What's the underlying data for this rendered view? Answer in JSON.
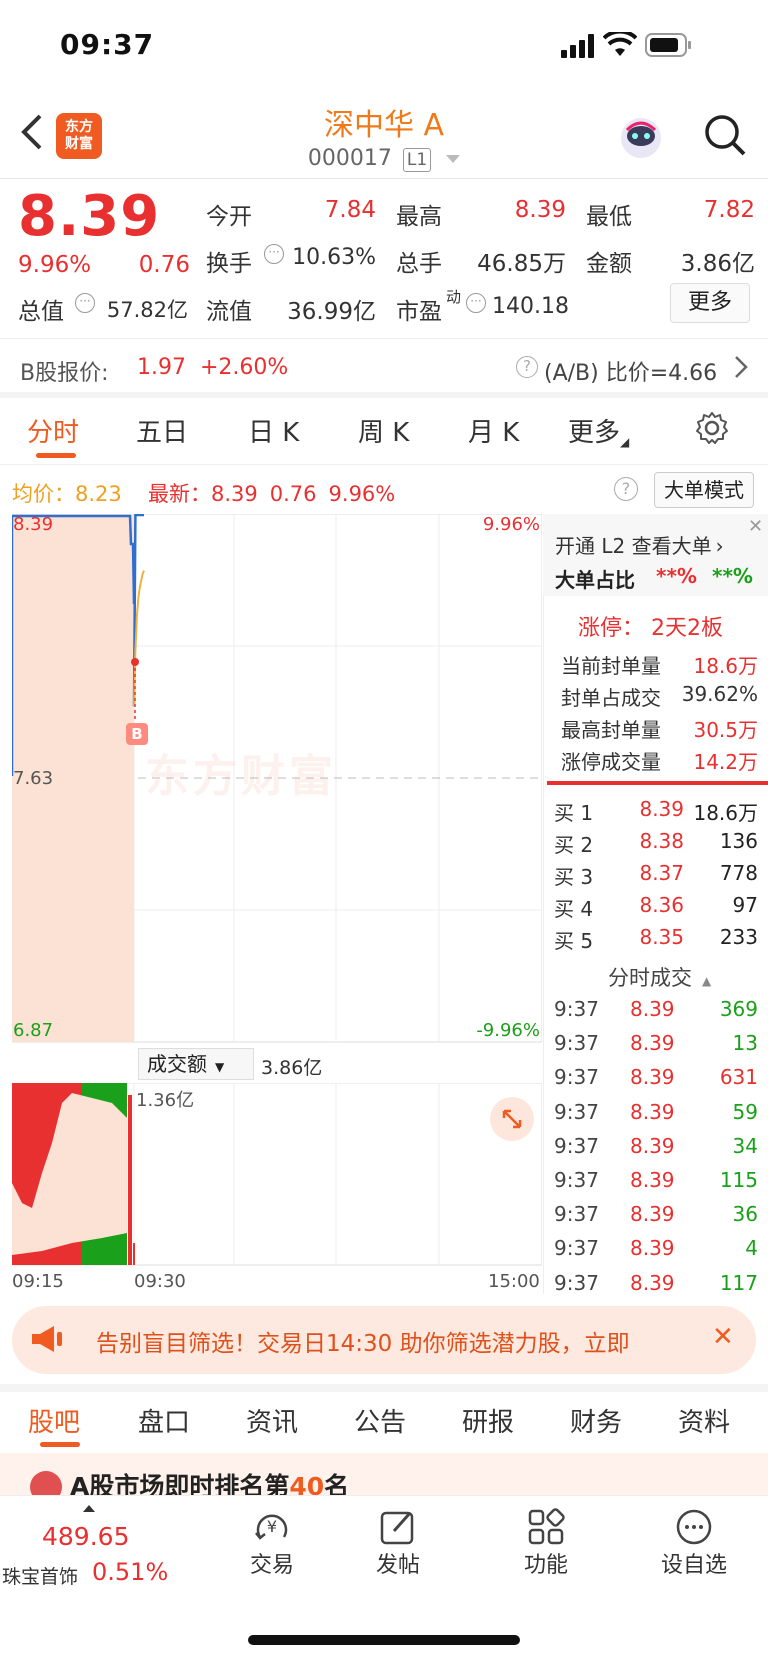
{
  "status_bar": {
    "time": "09:37"
  },
  "header": {
    "logo_text_1": "东方",
    "logo_text_2": "财富",
    "title": "深中华 A",
    "code": "000017",
    "level": "L1"
  },
  "quote": {
    "price": "8.39",
    "change_pct": "9.96%",
    "change": "0.76",
    "open_label": "今开",
    "open": "7.84",
    "high_label": "最高",
    "high": "8.39",
    "low_label": "最低",
    "low": "7.82",
    "turnover_label": "换手",
    "turnover": "10.63%",
    "volume_label": "总手",
    "volume": "46.85万",
    "amount_label": "金额",
    "amount": "3.86亿",
    "mcap_label": "总值",
    "mcap": "57.82亿",
    "float_label": "流值",
    "float_cap": "36.99亿",
    "pe_label": "市盈",
    "pe_sup": "动",
    "pe": "140.18",
    "more_label": "更多"
  },
  "b_share": {
    "label": "B股报价:",
    "price": "1.97",
    "change_pct": "+2.60%",
    "ratio_label": "(A/B) 比价=4.66"
  },
  "chart_tabs": [
    "分时",
    "五日",
    "日 K",
    "周 K",
    "月 K",
    "更多"
  ],
  "legend": {
    "avg_label": "均价：",
    "avg": "8.23",
    "latest_label": "最新：",
    "latest": "8.39",
    "change": "0.76",
    "change_pct": "9.96%",
    "big_order_mode": "大单模式"
  },
  "chart_labels": {
    "top_price": "8.39",
    "top_pct": "9.96%",
    "mid_price": "7.63",
    "bottom_price": "6.87",
    "bottom_pct": "-9.96%",
    "watermark": "东方财富",
    "b_marker": "B",
    "vol_selector": "成交额",
    "vol_total": "3.86亿",
    "vol_max": "1.36亿",
    "time_start": "09:15",
    "time_mid": "09:30",
    "time_end": "15:00"
  },
  "chart_data": {
    "type": "line",
    "x": [
      "09:30",
      "09:31",
      "09:32",
      "09:33",
      "09:34",
      "09:35",
      "09:36",
      "09:37"
    ],
    "series": [
      {
        "name": "price",
        "values": [
          7.84,
          8.39,
          8.39,
          8.39,
          8.39,
          8.39,
          8.39,
          8.39
        ]
      },
      {
        "name": "avg",
        "values": [
          7.84,
          8.0,
          8.1,
          8.15,
          8.18,
          8.2,
          8.22,
          8.23
        ]
      }
    ],
    "ylim": [
      6.87,
      8.39
    ],
    "title": ""
  },
  "side_panel": {
    "l2_link": "开通 L2 查看大单",
    "big_ratio_label": "大单占比",
    "big_ratio_red": "**%",
    "big_ratio_green": "**%",
    "limit_up": "涨停：  2天2板",
    "seal_items": [
      {
        "label": "当前封单量",
        "value": "18.6万"
      },
      {
        "label": "封单占成交",
        "value": "39.62%"
      },
      {
        "label": "最高封单量",
        "value": "30.5万"
      },
      {
        "label": "涨停成交量",
        "value": "14.2万"
      }
    ],
    "bids": [
      {
        "label": "买 1",
        "price": "8.39",
        "vol": "18.6万"
      },
      {
        "label": "买 2",
        "price": "8.38",
        "vol": "136"
      },
      {
        "label": "买 3",
        "price": "8.37",
        "vol": "778"
      },
      {
        "label": "买 4",
        "price": "8.36",
        "vol": "97"
      },
      {
        "label": "买 5",
        "price": "8.35",
        "vol": "233"
      }
    ],
    "ticks_title": "分时成交",
    "ticks": [
      {
        "time": "9:37",
        "price": "8.39",
        "vol": "369"
      },
      {
        "time": "9:37",
        "price": "8.39",
        "vol": "13"
      },
      {
        "time": "9:37",
        "price": "8.39",
        "vol": "631"
      },
      {
        "time": "9:37",
        "price": "8.39",
        "vol": "59"
      },
      {
        "time": "9:37",
        "price": "8.39",
        "vol": "34"
      },
      {
        "time": "9:37",
        "price": "8.39",
        "vol": "115"
      },
      {
        "time": "9:37",
        "price": "8.39",
        "vol": "36"
      },
      {
        "time": "9:37",
        "price": "8.39",
        "vol": "4"
      },
      {
        "time": "9:37",
        "price": "8.39",
        "vol": "117"
      }
    ]
  },
  "banner": {
    "text": "告别盲目筛选！交易日14:30 助你筛选潜力股，立即"
  },
  "bottom_tabs": [
    "股吧",
    "盘口",
    "资讯",
    "公告",
    "研报",
    "财务",
    "资料"
  ],
  "rank_strip": {
    "prefix": "A股市场即时排名第",
    "rank": "40",
    "suffix": "名"
  },
  "bottom_bar": {
    "sector_value": "489.65",
    "sector_name": "珠宝首饰",
    "sector_pct": "0.51%",
    "items": [
      "交易",
      "发帖",
      "功能",
      "设自选"
    ]
  }
}
